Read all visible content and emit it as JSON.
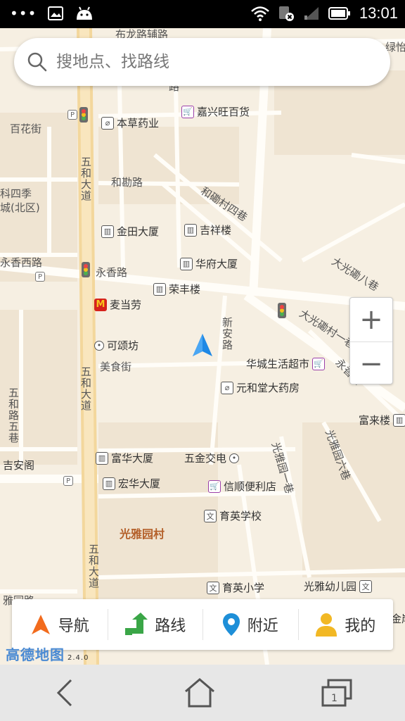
{
  "status_bar": {
    "time": "13:01",
    "icons": [
      "more-dots-icon",
      "image-icon",
      "android-icon",
      "wifi-icon",
      "sim-card-icon",
      "signal-icon",
      "battery-icon"
    ]
  },
  "search": {
    "placeholder": "搜地点、找路线"
  },
  "map": {
    "roads": {
      "buli_fulu": "布龙路辅路",
      "baihua_street": "百花街",
      "wuhe_avenue_1": "五和大道",
      "wuhe_avenue_2": "五和大道",
      "wuhe_avenue_3": "五和大道",
      "heqin_road": "和勘路",
      "heqin_village_4": "和磡村四巷",
      "yongxiang_west": "永香西路",
      "yongxiang_road": "永香路",
      "xinan_road": "新安路",
      "meishi_street": "美食街",
      "daguang_8": "大光磡八巷",
      "daguang_1": "大光磡村一巷",
      "yongxiang_right": "永香路",
      "wuhe_5": "五和路五巷",
      "guangya_1": "光雅园一巷",
      "guangya_6": "光雅园六巷",
      "ya_road": "雅园路",
      "road_lu": "路",
      "green_valley": "绿怡",
      "four_seasons": "科四季",
      "city_north": "城(北区)"
    },
    "pois": {
      "bencao": "本草药业",
      "jiaxingwang": "嘉兴旺百货",
      "jintian": "金田大厦",
      "jixiang": "吉祥楼",
      "huafu": "华府大厦",
      "rongfeng": "荣丰楼",
      "mcdonalds": "麦当劳",
      "kesong": "可颂坊",
      "huacheng": "华城生活超市",
      "yuanhetang": "元和堂大药房",
      "fulai": "富来楼",
      "fuhua": "富华大厦",
      "wujin": "五金交电",
      "jian": "吉安阁",
      "honghua": "宏华大厦",
      "xinshun": "信顺便利店",
      "yuying_school": "育英学校",
      "guangya_village": "光雅园村",
      "yuying_primary": "育英小学",
      "guangya_kinder": "光雅幼儿园",
      "jin_partial": "金岸"
    }
  },
  "zoom": {
    "in_label": "+",
    "out_label": "−"
  },
  "toolbar": {
    "navigate": "导航",
    "route": "路线",
    "nearby": "附近",
    "mine": "我的"
  },
  "logo": {
    "name": "高德地图",
    "version": "2.4.0"
  },
  "colors": {
    "map_bg": "#f6efe2",
    "road": "#fffdf8",
    "main_road": "#f7e2b0",
    "block": "#efe4d2",
    "accent_blue": "#1e88e5",
    "nav_orange": "#f26b1d",
    "route_green": "#3aa647",
    "nearby_blue": "#1e8fd8",
    "mine_yellow": "#f2b824"
  }
}
